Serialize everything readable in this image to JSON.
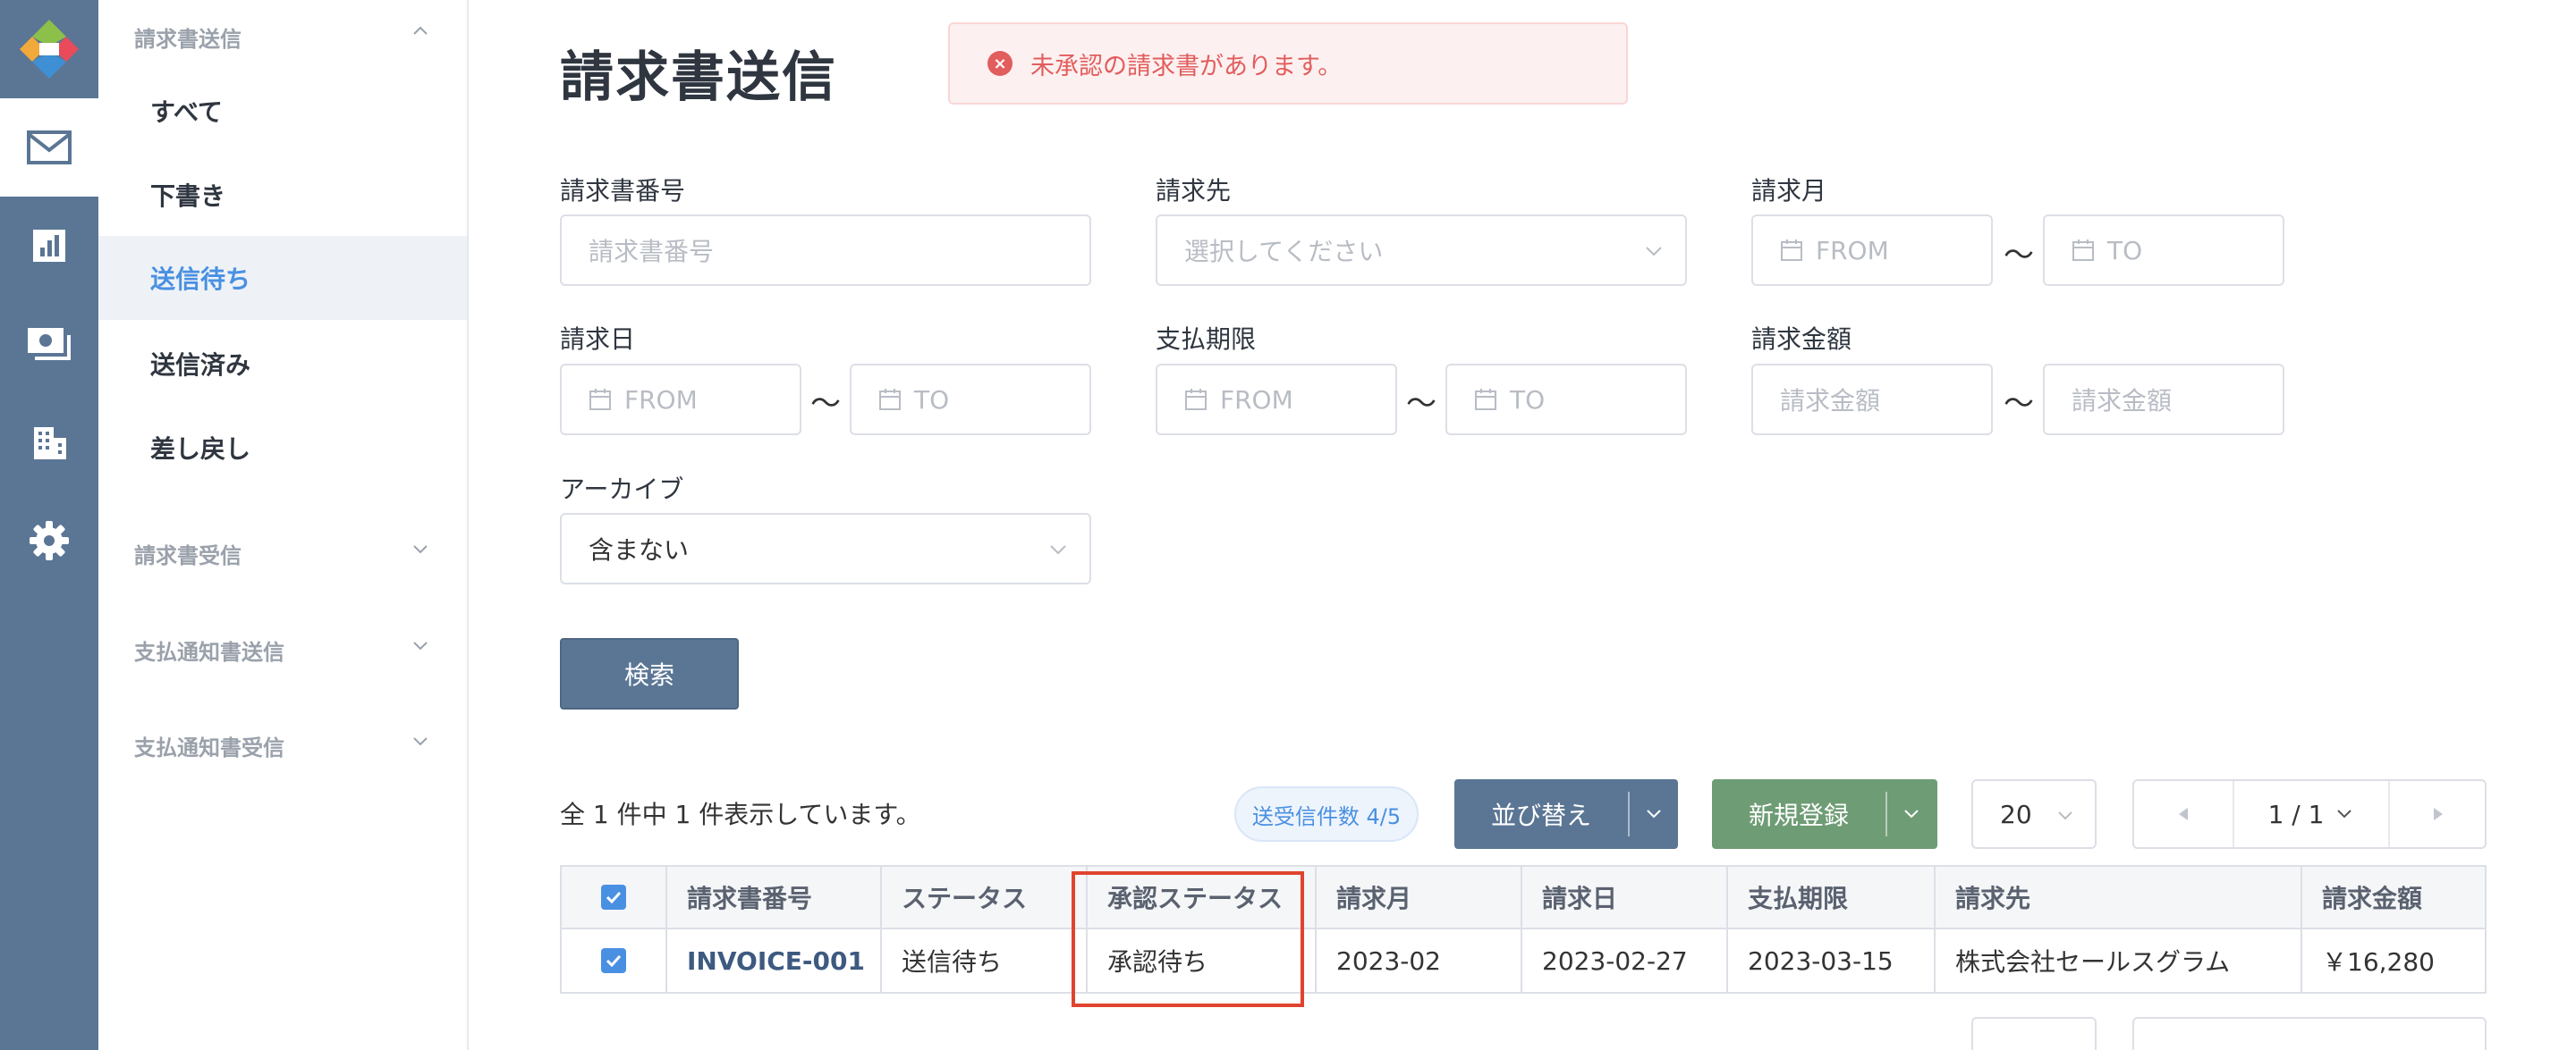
{
  "rail": {
    "items": [
      {
        "icon": "mail-icon",
        "active": true
      },
      {
        "icon": "chart-icon",
        "active": false
      },
      {
        "icon": "payment-icon",
        "active": false
      },
      {
        "icon": "building-icon",
        "active": false
      },
      {
        "icon": "gear-icon",
        "active": false
      }
    ]
  },
  "sidebar": {
    "group_send": "請求書送信",
    "items": [
      "すべて",
      "下書き",
      "送信待ち",
      "送信済み",
      "差し戻し"
    ],
    "active_item": "送信待ち",
    "group_receive": "請求書受信",
    "group_payment_send": "支払通知書送信",
    "group_payment_receive": "支払通知書受信"
  },
  "page": {
    "title": "請求書送信",
    "alert": "未承認の請求書があります。"
  },
  "filters": {
    "invoice_number": {
      "label": "請求書番号",
      "placeholder": "請求書番号"
    },
    "recipient": {
      "label": "請求先",
      "placeholder": "選択してください"
    },
    "billing_month": {
      "label": "請求月",
      "from": "FROM",
      "to": "TO"
    },
    "billing_date": {
      "label": "請求日",
      "from": "FROM",
      "to": "TO"
    },
    "payment_due": {
      "label": "支払期限",
      "from": "FROM",
      "to": "TO"
    },
    "amount": {
      "label": "請求金額",
      "from": "請求金額",
      "to": "請求金額"
    },
    "archive": {
      "label": "アーカイブ",
      "value": "含まない"
    },
    "range_sep": "〜",
    "search_button": "検索"
  },
  "results": {
    "count_text": "全 1 件中 1 件表示しています。",
    "badge": "送受信件数 4/5",
    "sort_button": "並び替え",
    "new_button": "新規登録",
    "per_page": "20",
    "page_indicator": "1 / 1"
  },
  "table": {
    "columns": [
      "請求書番号",
      "ステータス",
      "承認ステータス",
      "請求月",
      "請求日",
      "支払期限",
      "請求先",
      "請求金額"
    ],
    "rows": [
      {
        "invoice_number": "INVOICE-001",
        "status": "送信待ち",
        "approval_status": "承認待ち",
        "billing_month": "2023-02",
        "billing_date": "2023-02-27",
        "payment_due": "2023-03-15",
        "recipient": "株式会社セールスグラム",
        "amount": "￥16,280"
      }
    ]
  },
  "colors": {
    "rail": "#5b7694",
    "accent_blue": "#4a90e2",
    "new_green": "#6e9c74",
    "alert_red": "#e25d5d",
    "highlight": "#e0442e"
  }
}
